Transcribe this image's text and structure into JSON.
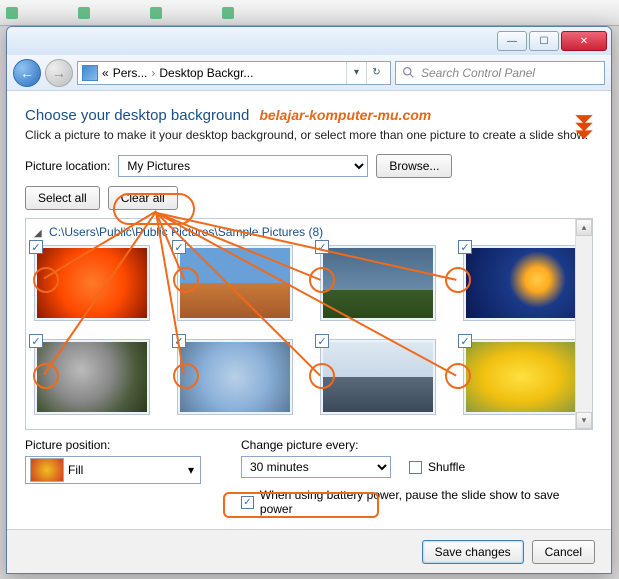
{
  "browser_tabs": [
    "",
    "",
    "",
    ""
  ],
  "titlebar": {
    "minimize": "—",
    "maximize": "☐",
    "close": "✕"
  },
  "nav": {
    "back": "←",
    "forward": "→",
    "chevrons": "«",
    "crumb1": "Pers...",
    "sep": "›",
    "crumb2": "Desktop Backgr...",
    "dropdown": "▾",
    "refresh": "↻",
    "search_placeholder": "Search Control Panel"
  },
  "page": {
    "title": "Choose your desktop background",
    "watermark": "belajar-komputer-mu.com",
    "subtitle": "Click a picture to make it your desktop background, or select more than one picture to create a slide show."
  },
  "location": {
    "label": "Picture location:",
    "value": "My Pictures",
    "browse": "Browse..."
  },
  "buttons": {
    "select_all": "Select all",
    "clear_all": "Clear all"
  },
  "gallery": {
    "tri": "◢",
    "group_label": "C:\\Users\\Public\\Public Pictures\\Sample Pictures (8)",
    "items": [
      {
        "name": "chrysanthemum",
        "cls": "img-flower",
        "checked": true
      },
      {
        "name": "desert",
        "cls": "img-desert",
        "checked": true
      },
      {
        "name": "lighthouse",
        "cls": "img-lighthouse",
        "checked": true
      },
      {
        "name": "jellyfish",
        "cls": "img-jellyfish",
        "checked": true
      },
      {
        "name": "koala",
        "cls": "img-koala",
        "checked": true
      },
      {
        "name": "hydrangeas",
        "cls": "img-hydrangea",
        "checked": true
      },
      {
        "name": "penguins",
        "cls": "img-penguins",
        "checked": true
      },
      {
        "name": "tulips",
        "cls": "img-tulips",
        "checked": true
      }
    ]
  },
  "position": {
    "label": "Picture position:",
    "value": "Fill",
    "dd": "▾"
  },
  "change": {
    "label": "Change picture every:",
    "value": "30 minutes",
    "shuffle_label": "Shuffle",
    "battery_label": "When using battery power, pause the slide show to save power",
    "battery_checked": true,
    "check": "✓"
  },
  "footer": {
    "save": "Save changes",
    "cancel": "Cancel"
  }
}
